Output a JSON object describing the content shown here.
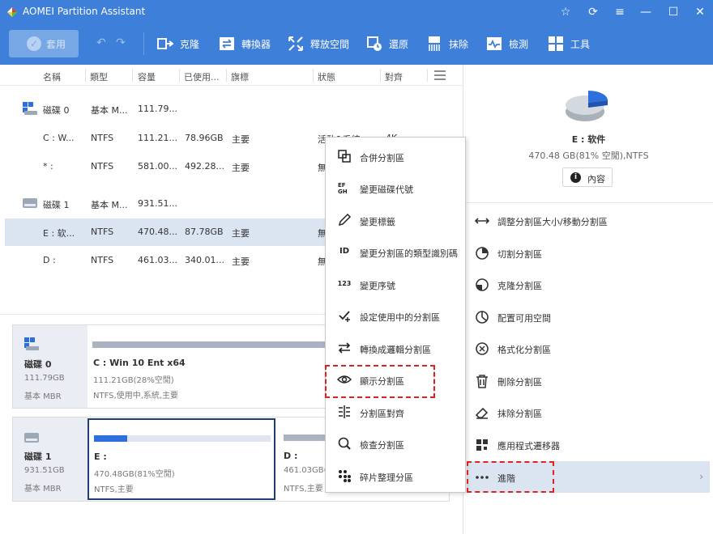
{
  "app": {
    "title": "AOMEI Partition Assistant"
  },
  "titlebar": {
    "buttons": [
      "star-icon",
      "refresh-icon",
      "menu-icon",
      "minimize-icon",
      "maximize-icon",
      "close-icon"
    ]
  },
  "toolbar": {
    "apply": "套用",
    "items": [
      {
        "label": "克隆",
        "icon": "clone-icon"
      },
      {
        "label": "轉換器",
        "icon": "convert-icon"
      },
      {
        "label": "釋放空間",
        "icon": "free-space-icon"
      },
      {
        "label": "還原",
        "icon": "restore-icon"
      },
      {
        "label": "抹除",
        "icon": "wipe-icon"
      },
      {
        "label": "檢測",
        "icon": "test-icon"
      },
      {
        "label": "工具",
        "icon": "tools-icon"
      }
    ]
  },
  "table": {
    "headers": [
      "名稱",
      "類型",
      "容量",
      "已使用...",
      "旗標",
      "狀態",
      "對齊"
    ],
    "rows": [
      {
        "kind": "disk",
        "name": "磁碟 0",
        "type": "基本 M...",
        "cap": "111.79...",
        "used": "",
        "flag": "",
        "status": "",
        "align": ""
      },
      {
        "kind": "part",
        "name": "C : W...",
        "type": "NTFS",
        "cap": "111.21...",
        "used": "78.96GB",
        "flag": "主要",
        "status": "活動&系統",
        "align": "4K"
      },
      {
        "kind": "part",
        "name": "* :",
        "type": "NTFS",
        "cap": "581.00...",
        "used": "492.28...",
        "flag": "主要",
        "status": "無",
        "align": ""
      },
      {
        "kind": "disk",
        "name": "磁碟 1",
        "type": "基本 M...",
        "cap": "931.51...",
        "used": "",
        "flag": "",
        "status": "",
        "align": ""
      },
      {
        "kind": "part",
        "name": "E : 软...",
        "type": "NTFS",
        "cap": "470.48...",
        "used": "87.78GB",
        "flag": "主要",
        "status": "無",
        "align": ""
      },
      {
        "kind": "part",
        "name": "D :",
        "type": "NTFS",
        "cap": "461.03...",
        "used": "340.01...",
        "flag": "主要",
        "status": "無",
        "align": ""
      }
    ]
  },
  "disks": [
    {
      "name": "磁碟 0",
      "size": "111.79GB",
      "type": "基本 MBR",
      "partitions": [
        {
          "name": "C : Win 10 Ent x64",
          "info1": "111.21GB(28%空閒)",
          "info2": "NTFS,使用中,系統,主要",
          "used_fraction": 0.72
        }
      ]
    },
    {
      "name": "磁碟 1",
      "size": "931.51GB",
      "type": "基本 MBR",
      "partitions": [
        {
          "name": "E :",
          "info1": "470.48GB(81%空閒)",
          "info2": "NTFS,主要",
          "used_fraction": 0.19
        },
        {
          "name": "D :",
          "info1": "461.03GB(",
          "info2": "NTFS,主要",
          "used_fraction": 0.74
        }
      ]
    }
  ],
  "right": {
    "title": "E : 软件",
    "subtitle": "470.48 GB(81% 空閒),NTFS",
    "prop_button": "內容",
    "ops": [
      {
        "label": "調整分割區大小/移動分割區",
        "icon": "resize-icon"
      },
      {
        "label": "切割分割區",
        "icon": "split-icon"
      },
      {
        "label": "克隆分割區",
        "icon": "clone-partition-icon"
      },
      {
        "label": "配置可用空間",
        "icon": "allocate-icon"
      },
      {
        "label": "格式化分割區",
        "icon": "format-icon"
      },
      {
        "label": "刪除分割區",
        "icon": "delete-icon"
      },
      {
        "label": "抹除分割區",
        "icon": "eraser-icon"
      },
      {
        "label": "應用程式遷移器",
        "icon": "app-mover-icon"
      },
      {
        "label": "進階",
        "icon": "more-icon"
      }
    ]
  },
  "context_menu": {
    "items": [
      {
        "label": "合併分割區",
        "icon": "merge-icon",
        "glyph": ""
      },
      {
        "label": "變更磁碟代號",
        "icon": "drive-letter-icon",
        "glyph": "EF\nGH"
      },
      {
        "label": "變更標籤",
        "icon": "pencil-icon",
        "glyph": ""
      },
      {
        "label": "變更分割區的類型識別碼",
        "icon": "id-icon",
        "glyph": "ID"
      },
      {
        "label": "變更序號",
        "icon": "serial-icon",
        "glyph": "123"
      },
      {
        "label": "設定使用中的分割區",
        "icon": "set-active-icon",
        "glyph": ""
      },
      {
        "label": "轉換成邏輯分割區",
        "icon": "convert-logical-icon",
        "glyph": ""
      },
      {
        "label": "顯示分割區",
        "icon": "eye-icon",
        "glyph": ""
      },
      {
        "label": "分割區對齊",
        "icon": "align-icon",
        "glyph": ""
      },
      {
        "label": "檢查分割區",
        "icon": "check-partition-icon",
        "glyph": ""
      },
      {
        "label": "碎片整理分區",
        "icon": "defrag-icon",
        "glyph": ""
      }
    ]
  },
  "colors": {
    "accent": "#3d7fd9",
    "selection": "#dbe5f2",
    "highlight": "#dd2222",
    "bar": "#2d6fdc"
  }
}
